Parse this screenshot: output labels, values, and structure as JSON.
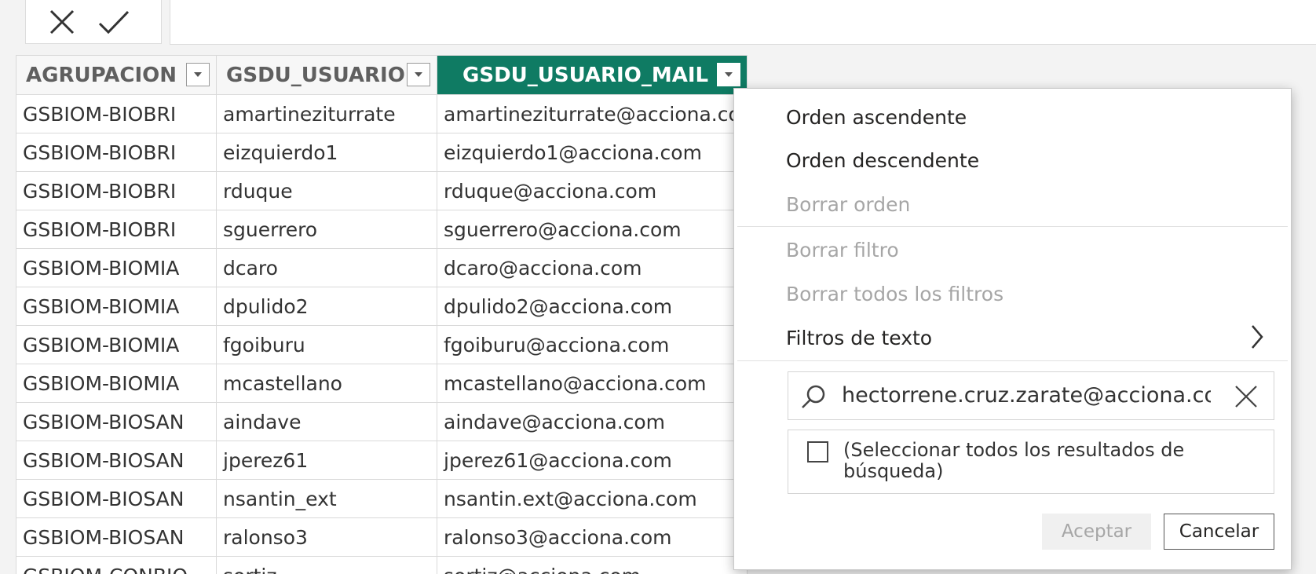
{
  "formula_bar": {
    "cancel_icon": "x-icon",
    "confirm_icon": "check-icon"
  },
  "grid": {
    "columns": [
      "AGRUPACION",
      "GSDU_USUARIO",
      "GSDU_USUARIO_MAIL"
    ],
    "rows": [
      [
        "GSBIOM-BIOBRI",
        "amartineziturrate",
        "amartineziturrate@acciona.co"
      ],
      [
        "GSBIOM-BIOBRI",
        "eizquierdo1",
        "eizquierdo1@acciona.com"
      ],
      [
        "GSBIOM-BIOBRI",
        "rduque",
        "rduque@acciona.com"
      ],
      [
        "GSBIOM-BIOBRI",
        "sguerrero",
        "sguerrero@acciona.com"
      ],
      [
        "GSBIOM-BIOMIA",
        "dcaro",
        "dcaro@acciona.com"
      ],
      [
        "GSBIOM-BIOMIA",
        "dpulido2",
        "dpulido2@acciona.com"
      ],
      [
        "GSBIOM-BIOMIA",
        "fgoiburu",
        "fgoiburu@acciona.com"
      ],
      [
        "GSBIOM-BIOMIA",
        "mcastellano",
        "mcastellano@acciona.com"
      ],
      [
        "GSBIOM-BIOSAN",
        "aindave",
        "aindave@acciona.com"
      ],
      [
        "GSBIOM-BIOSAN",
        "jperez61",
        "jperez61@acciona.com"
      ],
      [
        "GSBIOM-BIOSAN",
        "nsantin_ext",
        "nsantin.ext@acciona.com"
      ],
      [
        "GSBIOM-BIOSAN",
        "ralonso3",
        "ralonso3@acciona.com"
      ],
      [
        "GSBIOM-CONBIO",
        "sortiz",
        "sortiz@acciona.com"
      ]
    ],
    "active_header_color": "#0f7b63"
  },
  "menu": {
    "sort_asc": "Orden ascendente",
    "sort_desc": "Orden descendente",
    "clear_sort": "Borrar orden",
    "clear_filter": "Borrar filtro",
    "clear_all_filters": "Borrar todos los filtros",
    "text_filters": "Filtros de texto",
    "search": {
      "value": "hectorrene.cruz.zarate@acciona.com",
      "icon": "search-icon",
      "clear_icon": "close-icon"
    },
    "select_all_label": "(Seleccionar todos los resultados de búsqueda)",
    "ok_label": "Aceptar",
    "cancel_label": "Cancelar"
  }
}
